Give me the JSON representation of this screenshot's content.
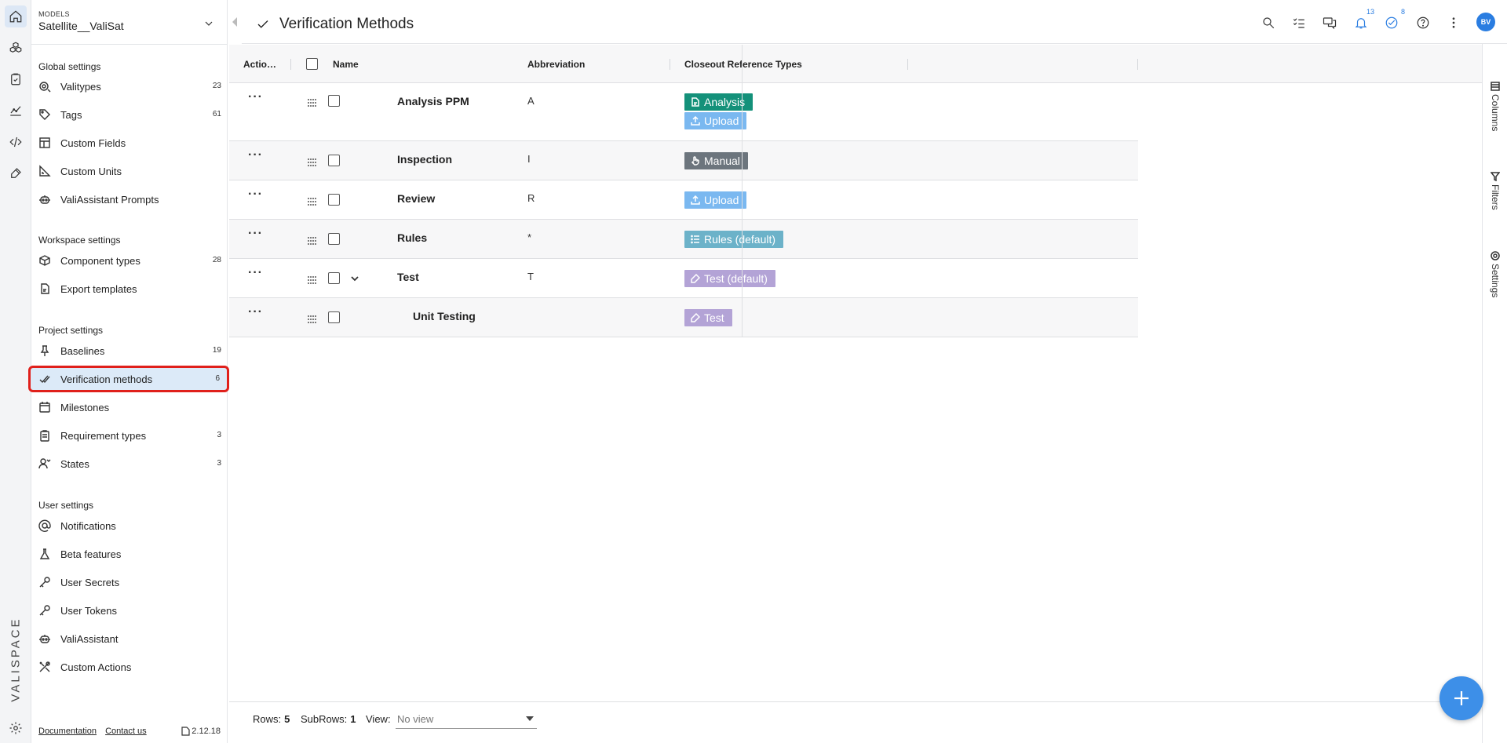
{
  "rail": {
    "brand": "VALISPACE",
    "icons": [
      "home-icon",
      "components-icon",
      "requirements-icon",
      "analyses-icon",
      "scripting-icon",
      "tests-icon",
      "settings-icon"
    ]
  },
  "model": {
    "caption": "MODELS",
    "name": "Satellite__ValiSat"
  },
  "sidebar": {
    "global": {
      "title": "Global settings",
      "items": [
        {
          "label": "Valitypes",
          "count": "23"
        },
        {
          "label": "Tags",
          "count": "61"
        },
        {
          "label": "Custom Fields",
          "count": ""
        },
        {
          "label": "Custom Units",
          "count": ""
        },
        {
          "label": "ValiAssistant Prompts",
          "count": ""
        }
      ]
    },
    "workspace": {
      "title": "Workspace settings",
      "items": [
        {
          "label": "Component types",
          "count": "28"
        },
        {
          "label": "Export templates",
          "count": ""
        }
      ]
    },
    "project": {
      "title": "Project settings",
      "items": [
        {
          "label": "Baselines",
          "count": "19"
        },
        {
          "label": "Verification methods",
          "count": "6"
        },
        {
          "label": "Milestones",
          "count": ""
        },
        {
          "label": "Requirement types",
          "count": "3"
        },
        {
          "label": "States",
          "count": "3"
        }
      ]
    },
    "user": {
      "title": "User settings",
      "items": [
        {
          "label": "Notifications"
        },
        {
          "label": "Beta features"
        },
        {
          "label": "User Secrets"
        },
        {
          "label": "User Tokens"
        },
        {
          "label": "ValiAssistant"
        },
        {
          "label": "Custom Actions"
        }
      ]
    },
    "footer": {
      "documentation": "Documentation",
      "contact": "Contact us",
      "version": "2.12.18"
    }
  },
  "header": {
    "title": "Verification Methods",
    "notifications_count": "13",
    "tasks_count": "8",
    "avatar_initials": "BV"
  },
  "right_panel": {
    "columns": "Columns",
    "filters": "Filters",
    "settings": "Settings"
  },
  "table": {
    "columns": {
      "actions": "Actio…",
      "name": "Name",
      "abbreviation": "Abbreviation",
      "closeout": "Closeout Reference Types"
    },
    "rows": [
      {
        "name": "Analysis PPM",
        "abbreviation": "A",
        "tags": [
          {
            "label": "Analysis",
            "color": "#14917a",
            "icon": "document-icon"
          },
          {
            "label": "Upload",
            "color": "#7ab8f0",
            "icon": "upload-icon"
          }
        ]
      },
      {
        "name": "Inspection",
        "abbreviation": "I",
        "tags": [
          {
            "label": "Manual",
            "color": "#6c757d",
            "icon": "hand-icon"
          }
        ]
      },
      {
        "name": "Review",
        "abbreviation": "R",
        "tags": [
          {
            "label": "Upload",
            "color": "#7ab8f0",
            "icon": "upload-icon"
          }
        ]
      },
      {
        "name": "Rules",
        "abbreviation": "*",
        "tags": [
          {
            "label": "Rules (default)",
            "color": "#6cb2c9",
            "icon": "list-icon"
          }
        ]
      },
      {
        "name": "Test",
        "abbreviation": "T",
        "tags": [
          {
            "label": "Test (default)",
            "color": "#b3a3d6",
            "icon": "test-icon"
          }
        ]
      },
      {
        "name": "Unit Testing",
        "abbreviation": "",
        "tags": [
          {
            "label": "Test",
            "color": "#b3a3d6",
            "icon": "test-icon"
          }
        ]
      }
    ]
  },
  "footer": {
    "rows_label": "Rows:",
    "rows_value": "5",
    "subrows_label": "SubRows:",
    "subrows_value": "1",
    "view_label": "View:",
    "view_placeholder": "No view"
  }
}
